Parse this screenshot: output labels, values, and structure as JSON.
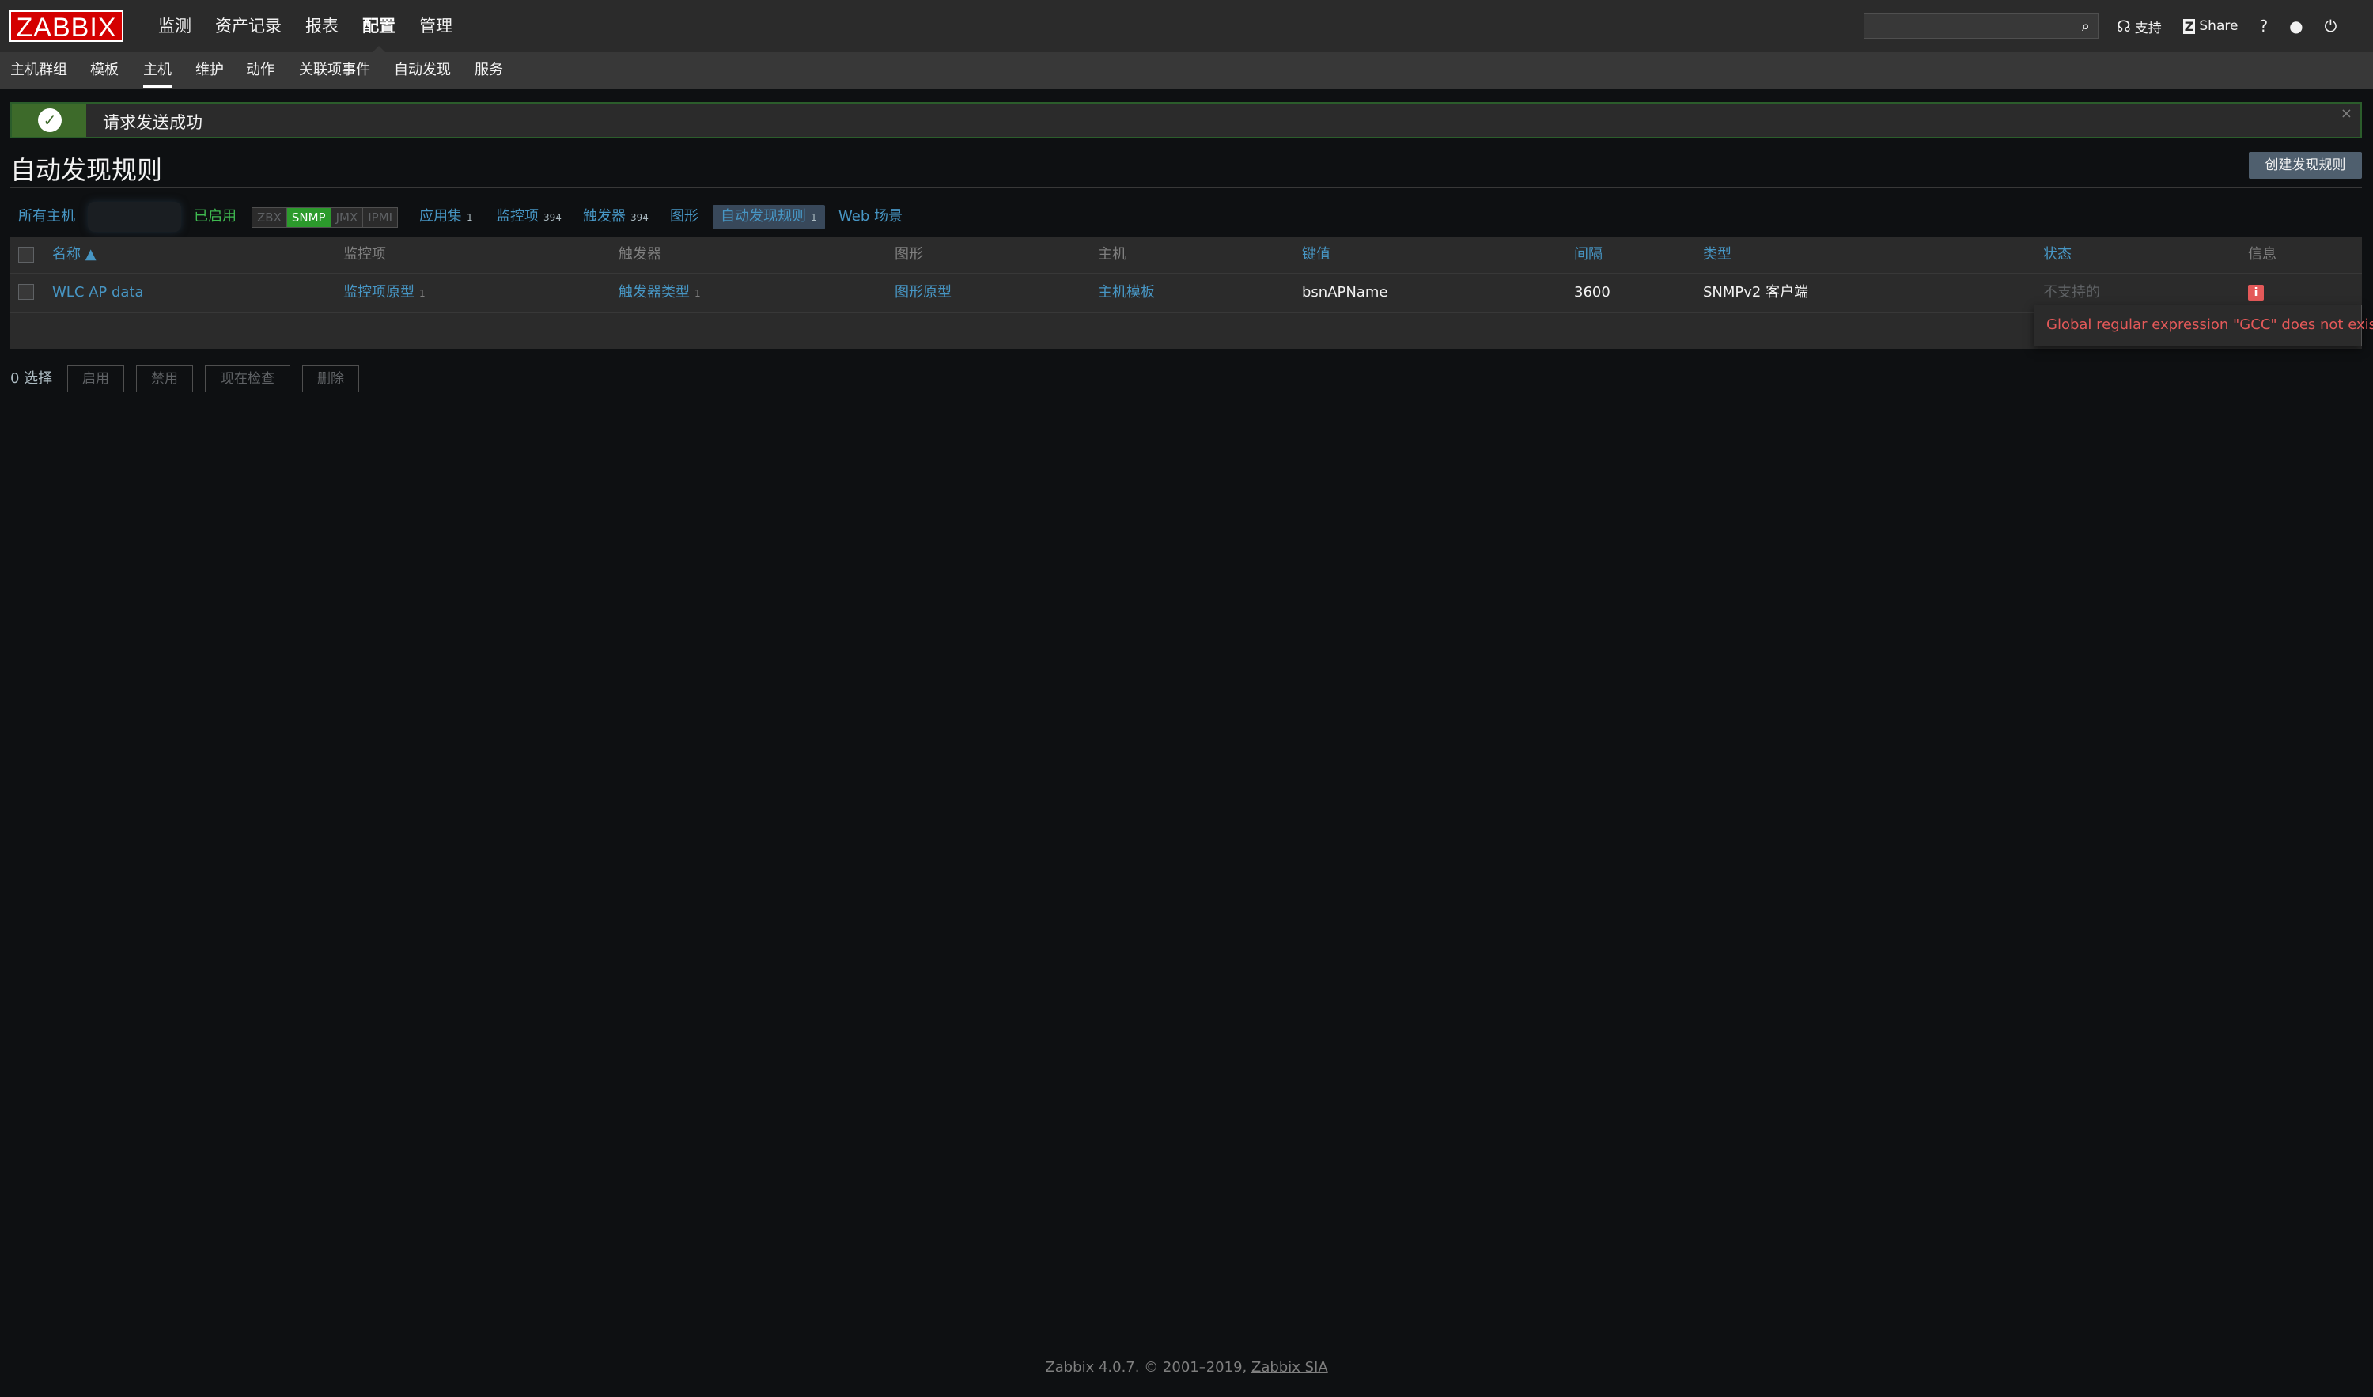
{
  "header": {
    "logo": "ZABBIX",
    "menu": [
      "监测",
      "资产记录",
      "报表",
      "配置",
      "管理"
    ],
    "active_menu": "配置",
    "search_placeholder": "",
    "links": {
      "support": "支持",
      "share": "Share",
      "help": "?"
    }
  },
  "subnav": [
    "主机群组",
    "模板",
    "主机",
    "维护",
    "动作",
    "关联项事件",
    "自动发现",
    "服务"
  ],
  "message": {
    "text": "请求发送成功",
    "close": "×"
  },
  "page": {
    "title": "自动发现规则",
    "create_button": "创建发现规则"
  },
  "host_nav": {
    "all_hosts": "所有主机",
    "enabled": "已启用",
    "interfaces": [
      "ZBX",
      "SNMP",
      "JMX",
      "IPMI"
    ],
    "active_interface": "SNMP",
    "applications": "应用集",
    "applications_count": "1",
    "items": "监控项",
    "items_count": "394",
    "triggers": "触发器",
    "triggers_count": "394",
    "graphs": "图形",
    "discovery": "自动发现规则",
    "discovery_count": "1",
    "web": "Web 场景"
  },
  "table": {
    "headers": {
      "name": "名称 ▲",
      "items": "监控项",
      "triggers": "触发器",
      "graphs": "图形",
      "hosts": "主机",
      "key": "键值",
      "interval": "间隔",
      "type": "类型",
      "status": "状态",
      "info": "信息"
    },
    "rows": [
      {
        "name": "WLC AP data",
        "items": "监控项原型",
        "items_count": "1",
        "triggers": "触发器类型",
        "triggers_count": "1",
        "graphs": "图形原型",
        "hosts": "主机模板",
        "key": "bsnAPName",
        "interval": "3600",
        "type": "SNMPv2 客户端",
        "status": "不支持的",
        "info_icon": "i"
      }
    ]
  },
  "tooltip": {
    "text": "Global regular expression \"GCC\" does not exist."
  },
  "actions": {
    "selected": "0 选择",
    "buttons": [
      "启用",
      "禁用",
      "现在检查",
      "删除"
    ]
  },
  "footer": {
    "text": "Zabbix 4.0.7. © 2001–2019,",
    "link": "Zabbix SIA"
  }
}
